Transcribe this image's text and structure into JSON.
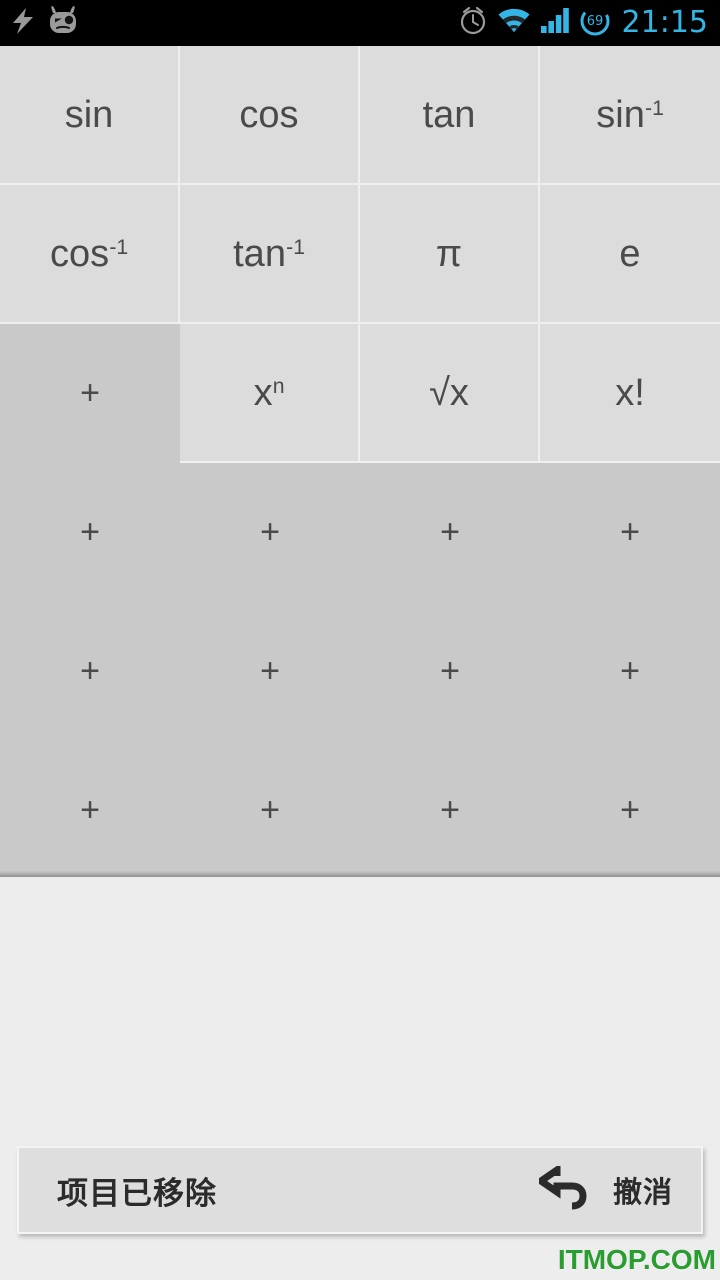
{
  "status_bar": {
    "background": "#000000",
    "clock_color": "#33b5e5",
    "time": "21:15",
    "left_icons": [
      {
        "name": "lightning-bolt-icon",
        "label": "charging"
      },
      {
        "name": "cyanogenmod-logo-icon",
        "label": "CyanogenMod"
      }
    ],
    "right_icons": [
      {
        "name": "alarm-clock-icon",
        "label": "alarm set"
      },
      {
        "name": "wifi-icon",
        "label": "wifi"
      },
      {
        "name": "cellular-signal-icon",
        "label": "signal"
      },
      {
        "name": "battery-circle-icon",
        "label": "battery",
        "value": "69"
      }
    ]
  },
  "palette": {
    "background": "#c9c9c9",
    "cell_background": "#dcdcdc",
    "cell_border": "#efefef",
    "label_color": "#4a4a4a",
    "empty_slot_glyph": "+",
    "buttons": [
      {
        "id": "sin",
        "base": "sin",
        "sup": "",
        "empty": false
      },
      {
        "id": "cos",
        "base": "cos",
        "sup": "",
        "empty": false
      },
      {
        "id": "tan",
        "base": "tan",
        "sup": "",
        "empty": false
      },
      {
        "id": "asin",
        "base": "sin",
        "sup": "-1",
        "empty": false
      },
      {
        "id": "acos",
        "base": "cos",
        "sup": "-1",
        "empty": false
      },
      {
        "id": "atan",
        "base": "tan",
        "sup": "-1",
        "empty": false
      },
      {
        "id": "pi",
        "base": "π",
        "sup": "",
        "empty": false
      },
      {
        "id": "e",
        "base": "e",
        "sup": "",
        "empty": false
      },
      {
        "id": "slot-r3c1",
        "base": "+",
        "sup": "",
        "empty": true
      },
      {
        "id": "power",
        "base": "x",
        "sup": "n",
        "empty": false
      },
      {
        "id": "sqrt",
        "base": "√x",
        "sup": "",
        "empty": false
      },
      {
        "id": "factorial",
        "base": "x!",
        "sup": "",
        "empty": false
      }
    ],
    "empty_slots": [
      "+",
      "+",
      "+",
      "+",
      "+",
      "+",
      "+",
      "+",
      "+",
      "+",
      "+",
      "+"
    ]
  },
  "lower_panel": {
    "background": "#ededed"
  },
  "snackbar": {
    "background": "#dedede",
    "message": "项目已移除",
    "action_label": "撤消",
    "action_icon": "undo-arrow-icon"
  },
  "watermark": {
    "text": "ITMOP.COM",
    "color": "#2a9c31"
  }
}
